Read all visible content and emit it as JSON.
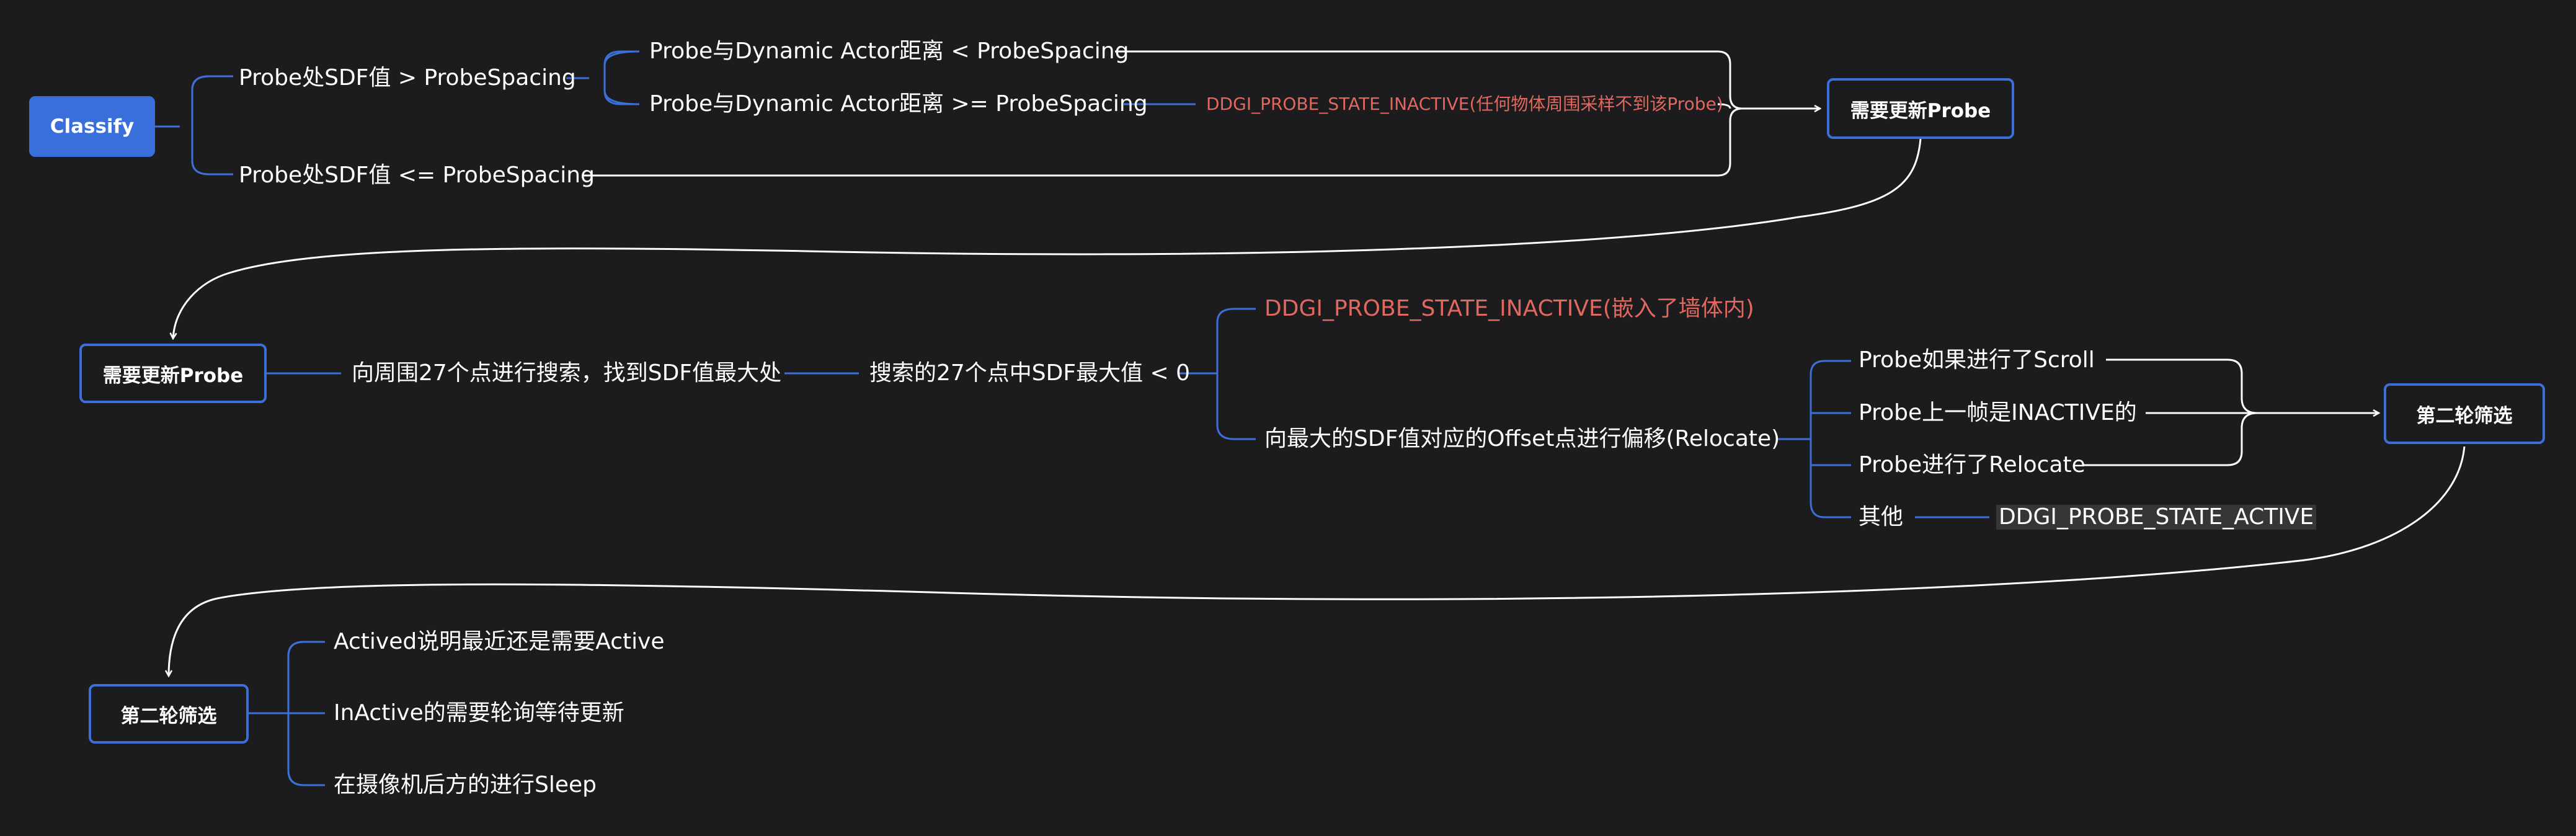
{
  "colors": {
    "background": "#1c1b1d",
    "connector": "#3d6fd8",
    "arrow": "#ffffff",
    "text": "#ffffff",
    "state_text": "#e0685e",
    "highlight_bg": "#363638"
  },
  "stage1": {
    "root": "Classify",
    "sdf_greater": "Probe处SDF值 > ProbeSpacing",
    "dist_less": "Probe与Dynamic Actor距离 < ProbeSpacing",
    "dist_greater_equal": "Probe与Dynamic Actor距离 >= ProbeSpacing",
    "inactive_state": "DDGI_PROBE_STATE_INACTIVE(任何物体周围采样不到该Probe)",
    "sdf_less_equal": "Probe处SDF值 <= ProbeSpacing",
    "target": "需要更新Probe"
  },
  "stage2": {
    "root": "需要更新Probe",
    "search": "向周围27个点进行搜索，找到SDF值最大处",
    "max_negative": "搜索的27个点中SDF最大值 < 0",
    "inactive_state": "DDGI_PROBE_STATE_INACTIVE(嵌入了墙体内)",
    "relocate": "向最大的SDF值对应的Offset点进行偏移(Relocate)",
    "scroll": "Probe如果进行了Scroll",
    "last_inactive": "Probe上一帧是INACTIVE的",
    "relocated": "Probe进行了Relocate",
    "other": "其他",
    "active_state": "DDGI_PROBE_STATE_ACTIVE",
    "target": "第二轮筛选"
  },
  "stage3": {
    "root": "第二轮筛选",
    "actived": "Actived说明最近还是需要Active",
    "inactive": "InActive的需要轮询等待更新",
    "sleep": "在摄像机后方的进行Sleep"
  }
}
